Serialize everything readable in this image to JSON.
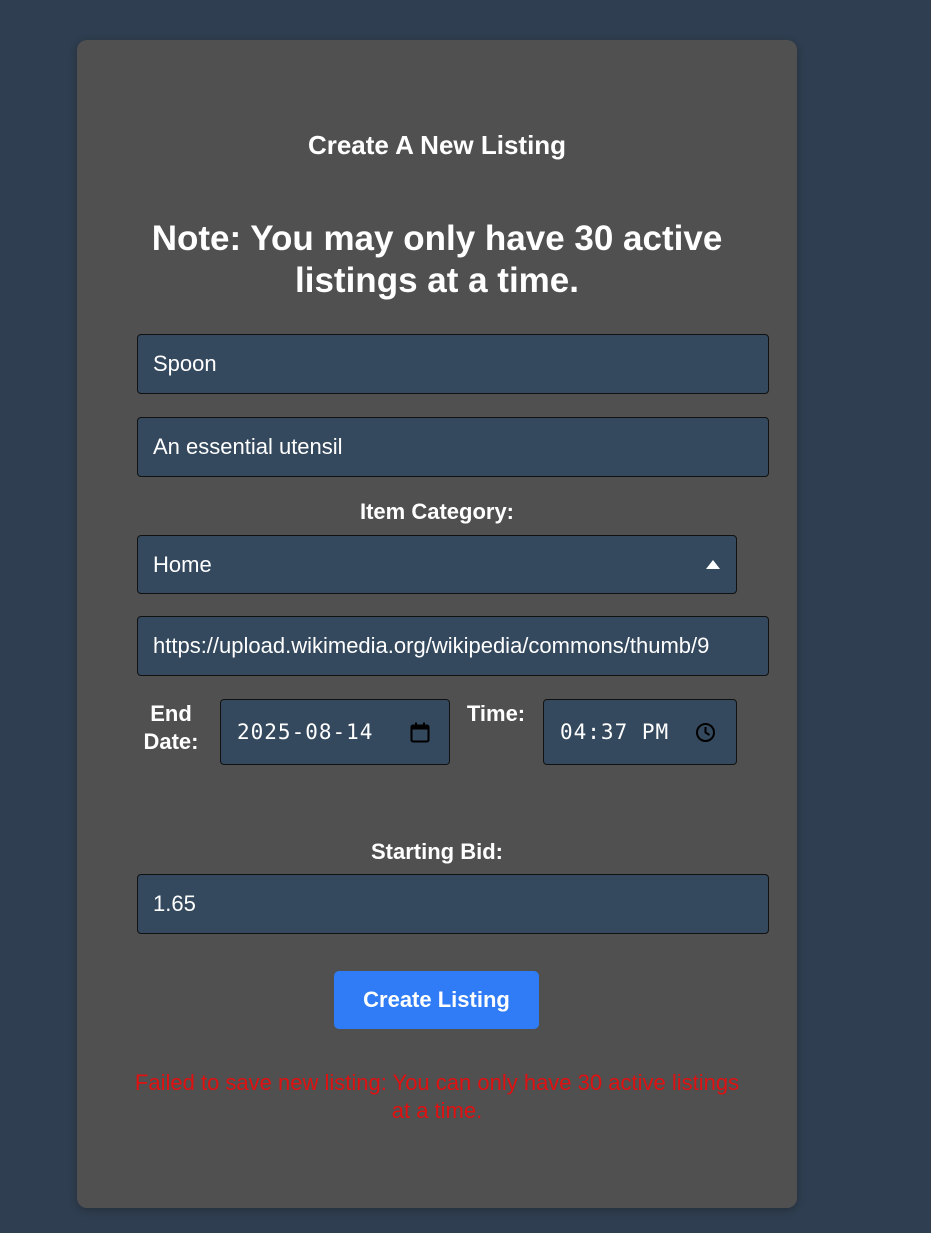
{
  "form": {
    "title": "Create A New Listing",
    "note": "Note: You may only have 30 active listings at a time.",
    "item_name_value": "Spoon",
    "description_value": "An essential utensil",
    "category_label": "Item Category:",
    "category_value": "Home",
    "image_url_value": "https://upload.wikimedia.org/wikipedia/commons/thumb/9",
    "end_date_label_line1": "End",
    "end_date_label_line2": "Date:",
    "end_date_value": "2025-08-14",
    "time_label": "Time:",
    "time_value": "04:37 PM",
    "starting_bid_label": "Starting Bid:",
    "starting_bid_value": "1.65",
    "submit_label": "Create Listing",
    "error_message": "Failed to save new listing: You can only have 30 active listings at a time."
  },
  "icons": {
    "dropdown": "caret-up-icon",
    "date": "calendar-icon",
    "time": "clock-icon"
  },
  "colors": {
    "background": "#2f3e50",
    "card": "#505050",
    "field": "#34495e",
    "button": "#2f7cf6",
    "error": "#e01010"
  }
}
